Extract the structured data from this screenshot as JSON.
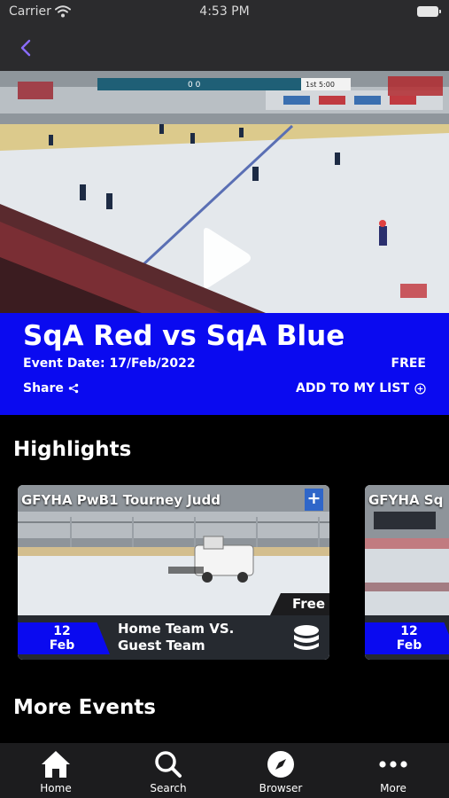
{
  "status_bar": {
    "carrier": "Carrier",
    "time": "4:53 PM"
  },
  "video": {
    "play_icon": "play-icon"
  },
  "event": {
    "title": "SqA Red vs SqA Blue",
    "date_text": "Event Date: 17/Feb/2022",
    "price": "FREE",
    "share_label": "Share",
    "add_to_list_label": "ADD TO MY LIST"
  },
  "highlights": {
    "heading": "Highlights",
    "cards": [
      {
        "title": "GFYHA PwB1 Tourney Judd",
        "price": "Free",
        "day": "12",
        "month": "Feb",
        "teams_line1": "Home Team VS.",
        "teams_line2": "Guest Team"
      },
      {
        "title": "GFYHA Sq",
        "day": "12",
        "month": "Feb"
      }
    ]
  },
  "more_events": {
    "heading": "More Events"
  },
  "tab_bar": {
    "items": [
      {
        "label": "Home",
        "icon": "home-icon"
      },
      {
        "label": "Search",
        "icon": "search-icon"
      },
      {
        "label": "Browser",
        "icon": "compass-icon"
      },
      {
        "label": "More",
        "icon": "more-icon"
      }
    ]
  },
  "colors": {
    "accent": "#0a0af0",
    "background": "#000000",
    "nav_bar": "#2b2b2d",
    "tab_bar": "#1c1c1e"
  }
}
